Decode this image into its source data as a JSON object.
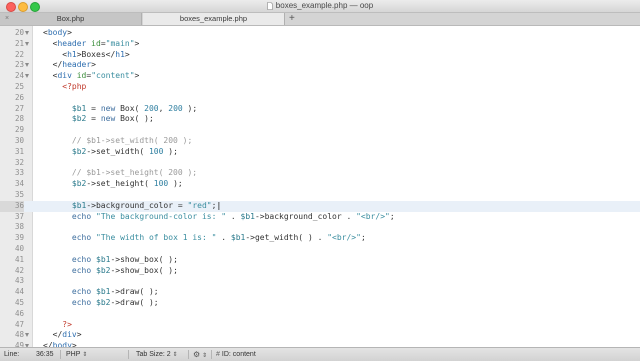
{
  "window": {
    "title": "boxes_example.php — oop"
  },
  "tabs": [
    {
      "label": "Box.php",
      "close_glyph": "×"
    },
    {
      "label": "boxes_example.php",
      "close_glyph": ""
    }
  ],
  "new_tab_glyph": "+",
  "editor": {
    "current_line": "36",
    "lines": [
      {
        "num": "20",
        "fold": true,
        "tokens": [
          {
            "t": "<",
            "c": "punct"
          },
          {
            "t": "body",
            "c": "tag"
          },
          {
            "t": ">",
            "c": "punct"
          }
        ]
      },
      {
        "num": "21",
        "fold": true,
        "tokens": [
          {
            "t": "  <",
            "c": "punct"
          },
          {
            "t": "header",
            "c": "tag"
          },
          {
            "t": " id",
            "c": "attr"
          },
          {
            "t": "=",
            "c": "punct"
          },
          {
            "t": "\"main\"",
            "c": "str"
          },
          {
            "t": ">",
            "c": "punct"
          }
        ]
      },
      {
        "num": "22",
        "fold": false,
        "tokens": [
          {
            "t": "    <",
            "c": "punct"
          },
          {
            "t": "h1",
            "c": "tag"
          },
          {
            "t": ">Boxes</",
            "c": "punct"
          },
          {
            "t": "h1",
            "c": "tag"
          },
          {
            "t": ">",
            "c": "punct"
          }
        ]
      },
      {
        "num": "23",
        "fold": true,
        "tokens": [
          {
            "t": "  </",
            "c": "punct"
          },
          {
            "t": "header",
            "c": "tag"
          },
          {
            "t": ">",
            "c": "punct"
          }
        ]
      },
      {
        "num": "24",
        "fold": true,
        "tokens": [
          {
            "t": "  <",
            "c": "punct"
          },
          {
            "t": "div",
            "c": "tag"
          },
          {
            "t": " id",
            "c": "attr"
          },
          {
            "t": "=",
            "c": "punct"
          },
          {
            "t": "\"content\"",
            "c": "str"
          },
          {
            "t": ">",
            "c": "punct"
          }
        ]
      },
      {
        "num": "25",
        "fold": false,
        "tokens": [
          {
            "t": "    <?php",
            "c": "phptag"
          }
        ]
      },
      {
        "num": "26",
        "fold": false,
        "tokens": []
      },
      {
        "num": "27",
        "fold": false,
        "tokens": [
          {
            "t": "      $b1",
            "c": "var"
          },
          {
            "t": " = ",
            "c": "punct"
          },
          {
            "t": "new",
            "c": "kw"
          },
          {
            "t": " Box( ",
            "c": "plain"
          },
          {
            "t": "200",
            "c": "num"
          },
          {
            "t": ", ",
            "c": "plain"
          },
          {
            "t": "200",
            "c": "num"
          },
          {
            "t": " );",
            "c": "plain"
          }
        ]
      },
      {
        "num": "28",
        "fold": false,
        "tokens": [
          {
            "t": "      $b2",
            "c": "var"
          },
          {
            "t": " = ",
            "c": "punct"
          },
          {
            "t": "new",
            "c": "kw"
          },
          {
            "t": " Box( );",
            "c": "plain"
          }
        ]
      },
      {
        "num": "29",
        "fold": false,
        "tokens": []
      },
      {
        "num": "30",
        "fold": false,
        "tokens": [
          {
            "t": "      // $b1->set_width( 200 );",
            "c": "comment"
          }
        ]
      },
      {
        "num": "31",
        "fold": false,
        "tokens": [
          {
            "t": "      $b2",
            "c": "var"
          },
          {
            "t": "->set_width( ",
            "c": "plain"
          },
          {
            "t": "100",
            "c": "num"
          },
          {
            "t": " );",
            "c": "plain"
          }
        ]
      },
      {
        "num": "32",
        "fold": false,
        "tokens": []
      },
      {
        "num": "33",
        "fold": false,
        "tokens": [
          {
            "t": "      // $b1->set_height( 200 );",
            "c": "comment"
          }
        ]
      },
      {
        "num": "34",
        "fold": false,
        "tokens": [
          {
            "t": "      $b2",
            "c": "var"
          },
          {
            "t": "->set_height( ",
            "c": "plain"
          },
          {
            "t": "100",
            "c": "num"
          },
          {
            "t": " );",
            "c": "plain"
          }
        ]
      },
      {
        "num": "35",
        "fold": false,
        "tokens": []
      },
      {
        "num": "36",
        "fold": false,
        "tokens": [
          {
            "t": "      $b1",
            "c": "var"
          },
          {
            "t": "->background_color = ",
            "c": "plain"
          },
          {
            "t": "\"red\"",
            "c": "str"
          },
          {
            "t": ";",
            "c": "plain"
          },
          {
            "t": "|",
            "c": "cursor"
          }
        ]
      },
      {
        "num": "37",
        "fold": false,
        "tokens": [
          {
            "t": "      echo",
            "c": "kw"
          },
          {
            "t": " ",
            "c": "plain"
          },
          {
            "t": "\"The background-color is: \"",
            "c": "str"
          },
          {
            "t": " . ",
            "c": "plain"
          },
          {
            "t": "$b1",
            "c": "var"
          },
          {
            "t": "->background_color . ",
            "c": "plain"
          },
          {
            "t": "\"<br/>\"",
            "c": "str"
          },
          {
            "t": ";",
            "c": "plain"
          }
        ]
      },
      {
        "num": "38",
        "fold": false,
        "tokens": []
      },
      {
        "num": "39",
        "fold": false,
        "tokens": [
          {
            "t": "      echo",
            "c": "kw"
          },
          {
            "t": " ",
            "c": "plain"
          },
          {
            "t": "\"The width of box 1 is: \"",
            "c": "str"
          },
          {
            "t": " . ",
            "c": "plain"
          },
          {
            "t": "$b1",
            "c": "var"
          },
          {
            "t": "->get_width( ) . ",
            "c": "plain"
          },
          {
            "t": "\"<br/>\"",
            "c": "str"
          },
          {
            "t": ";",
            "c": "plain"
          }
        ]
      },
      {
        "num": "40",
        "fold": false,
        "tokens": []
      },
      {
        "num": "41",
        "fold": false,
        "tokens": [
          {
            "t": "      echo",
            "c": "kw"
          },
          {
            "t": " ",
            "c": "plain"
          },
          {
            "t": "$b1",
            "c": "var"
          },
          {
            "t": "->show_box( );",
            "c": "plain"
          }
        ]
      },
      {
        "num": "42",
        "fold": false,
        "tokens": [
          {
            "t": "      echo",
            "c": "kw"
          },
          {
            "t": " ",
            "c": "plain"
          },
          {
            "t": "$b2",
            "c": "var"
          },
          {
            "t": "->show_box( );",
            "c": "plain"
          }
        ]
      },
      {
        "num": "43",
        "fold": false,
        "tokens": []
      },
      {
        "num": "44",
        "fold": false,
        "tokens": [
          {
            "t": "      echo",
            "c": "kw"
          },
          {
            "t": " ",
            "c": "plain"
          },
          {
            "t": "$b1",
            "c": "var"
          },
          {
            "t": "->draw( );",
            "c": "plain"
          }
        ]
      },
      {
        "num": "45",
        "fold": false,
        "tokens": [
          {
            "t": "      echo",
            "c": "kw"
          },
          {
            "t": " ",
            "c": "plain"
          },
          {
            "t": "$b2",
            "c": "var"
          },
          {
            "t": "->draw( );",
            "c": "plain"
          }
        ]
      },
      {
        "num": "46",
        "fold": false,
        "tokens": []
      },
      {
        "num": "47",
        "fold": false,
        "tokens": [
          {
            "t": "    ?>",
            "c": "phptag"
          }
        ]
      },
      {
        "num": "48",
        "fold": true,
        "tokens": [
          {
            "t": "  </",
            "c": "punct"
          },
          {
            "t": "div",
            "c": "tag"
          },
          {
            "t": ">",
            "c": "punct"
          }
        ]
      },
      {
        "num": "49",
        "fold": true,
        "tokens": [
          {
            "t": "</",
            "c": "punct"
          },
          {
            "t": "body",
            "c": "tag"
          },
          {
            "t": ">",
            "c": "punct"
          }
        ]
      }
    ]
  },
  "status": {
    "line_label": "Line:",
    "line_value": "36:35",
    "language": "PHP",
    "tab_size_label": "Tab Size:",
    "tab_size_value": "2",
    "symbol": "ID: content"
  },
  "colors": {
    "tag": "#2f6fb0",
    "attr": "#3a8d3a",
    "str": "#3b8ea0",
    "var": "#2a7a8c",
    "kw": "#3f6f9f",
    "num": "#2f7fa0",
    "comment": "#9a9a9a",
    "phptag": "#c0392b",
    "punct": "#333333",
    "plain": "#333333",
    "cursor": "#000000",
    "current_line_bg": "#e9f0f8"
  }
}
